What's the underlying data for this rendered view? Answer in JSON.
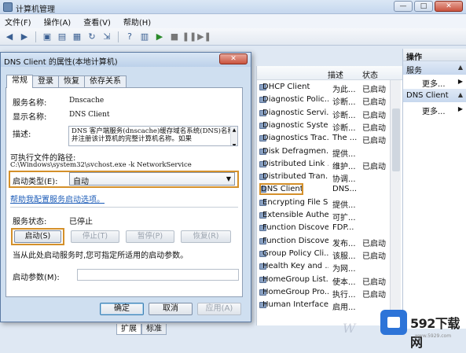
{
  "window": {
    "title": "计算机管理"
  },
  "menu": [
    "文件(F)",
    "操作(A)",
    "查看(V)",
    "帮助(H)"
  ],
  "services": {
    "columns": {
      "name": "",
      "desc": "描述",
      "status": "状态"
    },
    "rows": [
      {
        "name": "DHCP Client",
        "desc": "为此...",
        "status": "已启动"
      },
      {
        "name": "Diagnostic Polic...",
        "desc": "诊断...",
        "status": "已启动"
      },
      {
        "name": "Diagnostic Servi...",
        "desc": "诊断...",
        "status": "已启动"
      },
      {
        "name": "Diagnostic Syste...",
        "desc": "诊断...",
        "status": "已启动"
      },
      {
        "name": "Diagnostics Trac...",
        "desc": "The ...",
        "status": "已启动"
      },
      {
        "name": "Disk Defragmen...",
        "desc": "提供...",
        "status": ""
      },
      {
        "name": "Distributed Link ...",
        "desc": "维护...",
        "status": "已启动"
      },
      {
        "name": "Distributed Tran...",
        "desc": "协调...",
        "status": ""
      },
      {
        "name": "DNS Client",
        "desc": "DNS...",
        "status": ""
      },
      {
        "name": "Encrypting File S...",
        "desc": "提供...",
        "status": ""
      },
      {
        "name": "Extensible Authe...",
        "desc": "可扩...",
        "status": ""
      },
      {
        "name": "Function Discove...",
        "desc": "FDP...",
        "status": ""
      },
      {
        "name": "Function Discove...",
        "desc": "发布...",
        "status": "已启动"
      },
      {
        "name": "Group Policy Cli...",
        "desc": "该服...",
        "status": "已启动"
      },
      {
        "name": "Health Key and ...",
        "desc": "为网...",
        "status": ""
      },
      {
        "name": "HomeGroup List...",
        "desc": "使本...",
        "status": "已启动"
      },
      {
        "name": "HomeGroup Pro...",
        "desc": "执行...",
        "status": "已启动"
      },
      {
        "name": "Human Interface...",
        "desc": "启用...",
        "status": ""
      }
    ]
  },
  "bottom_tabs": [
    "扩展",
    "标准"
  ],
  "actions": {
    "header": "操作",
    "group1": "服务",
    "more1": "更多...",
    "group2": "DNS Client",
    "more2": "更多..."
  },
  "dialog": {
    "title": "DNS Client 的属性(本地计算机)",
    "close": "✕",
    "tabs": [
      "常规",
      "登录",
      "恢复",
      "依存关系"
    ],
    "service_name_label": "服务名称:",
    "service_name": "Dnscache",
    "display_name_label": "显示名称:",
    "display_name": "DNS Client",
    "description_label": "描述:",
    "description": "DNS 客户端服务(dnscache)缓存域名系统(DNS)名称并注册该计算机的完整计算机名称。如果",
    "exe_path_label": "可执行文件的路径:",
    "exe_path": "C:\\Windows\\system32\\svchost.exe -k NetworkService",
    "startup_type_label": "启动类型(E):",
    "startup_type": "自动",
    "help_link": "帮助我配置服务启动选项。",
    "status_label": "服务状态:",
    "status_value": "已停止",
    "btn_start": "启动(S)",
    "btn_stop": "停止(T)",
    "btn_pause": "暂停(P)",
    "btn_resume": "恢复(R)",
    "note": "当从此处启动服务时,您可指定所适用的启动参数。",
    "params_label": "启动参数(M):",
    "params_value": "",
    "ok": "确定",
    "cancel": "取消",
    "apply": "应用(A)"
  },
  "watermark": {
    "brand": "592下载网",
    "url": "www.5929.com"
  }
}
